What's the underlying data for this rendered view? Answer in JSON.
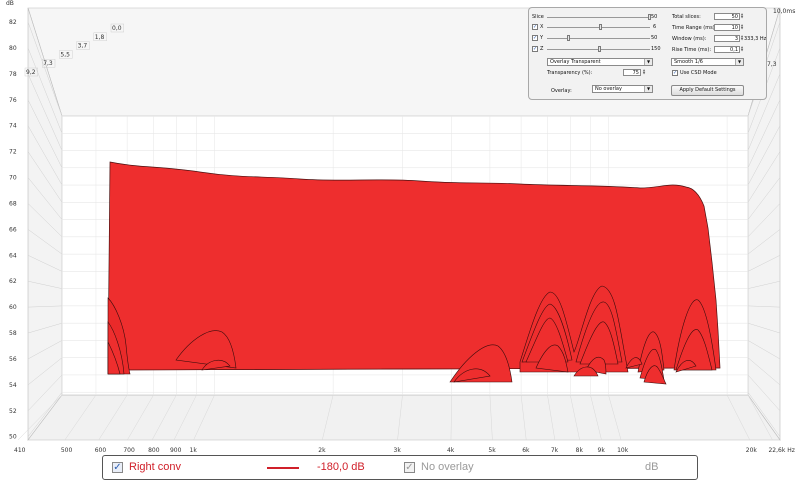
{
  "plot": {
    "y_unit": "dB",
    "y_ticks": [
      "82",
      "80",
      "78",
      "76",
      "74",
      "72",
      "70",
      "68",
      "66",
      "64",
      "62",
      "60",
      "58",
      "56",
      "54",
      "52",
      "50"
    ],
    "x_ticks": [
      "410",
      "500",
      "600",
      "700",
      "800",
      "900",
      "1k",
      "2k",
      "3k",
      "4k",
      "5k",
      "6k",
      "7k",
      "8k",
      "9k",
      "10k",
      "20k",
      "22,6k Hz"
    ],
    "z_top_left": [
      "9,2",
      "7,3",
      "5,5",
      "3,7",
      "1,8",
      "0,0"
    ],
    "z_right": [
      "10,0ms",
      "7,3"
    ],
    "surface_color": "#ee2e2e"
  },
  "settings": {
    "slice_label": "Slice",
    "slice_value": "50",
    "x_label": "X",
    "x_value": "6",
    "y_label": "Y",
    "y_value": "50",
    "z_label": "Z",
    "z_value": "150",
    "mode_select": "Overlay Transparent",
    "transparency_label": "Transparency (%):",
    "transparency_value": "75",
    "overlay_label": "Overlay:",
    "overlay_select": "No overlay",
    "total_slices_label": "Total slices:",
    "total_slices_value": "50",
    "time_range_label": "Time Range (ms):",
    "time_range_value": "10",
    "window_label": "Window (ms):",
    "window_value": "3",
    "window_freq": "333,3 Hz",
    "rise_time_label": "Rise Time (ms):",
    "rise_time_value": "0,1",
    "smooth_select": "Smooth 1/6",
    "use_csd_label": "Use CSD Mode",
    "apply_button": "Apply Default Settings"
  },
  "legend": {
    "series1_name": "Right conv",
    "series1_value": "-180,0 dB",
    "series1_color": "#d0202a",
    "series2_name": "No overlay",
    "series2_unit": "dB"
  }
}
